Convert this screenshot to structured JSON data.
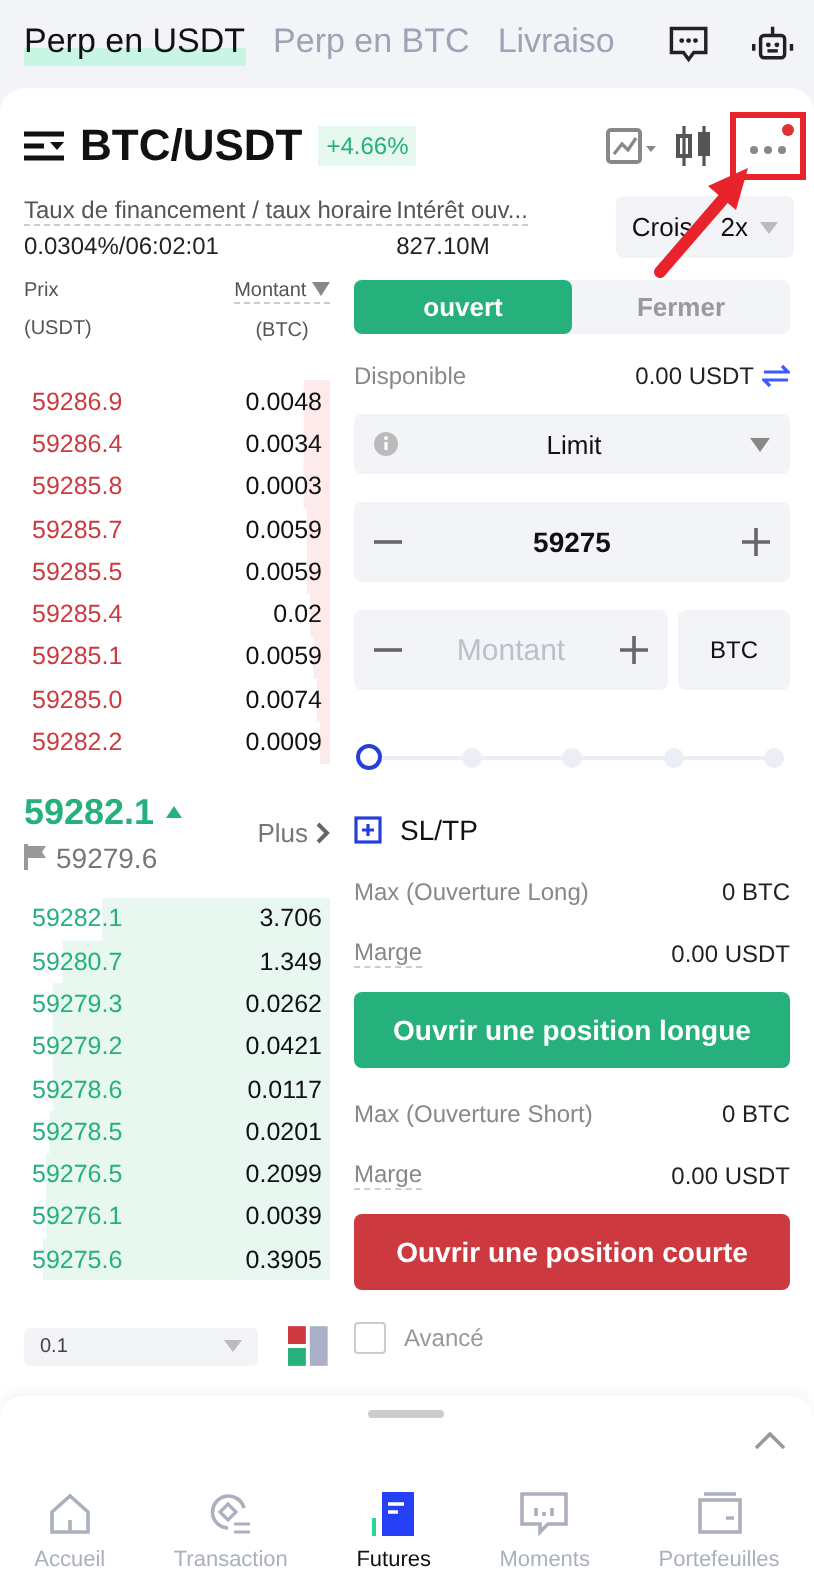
{
  "top_tabs": [
    {
      "label": "Perp en USDT",
      "selected": true
    },
    {
      "label": "Perp en BTC",
      "selected": false
    },
    {
      "label": "Livraiso",
      "selected": false
    }
  ],
  "pair": {
    "symbol": "BTC/USDT",
    "change": "+4.66%"
  },
  "funding": {
    "label": "Taux de financement / taux horaire",
    "value": "0.0304%/06:02:01"
  },
  "open_interest": {
    "label": "Intérêt ouv...",
    "value": "827.10M"
  },
  "margin_mode": [
    "Crois",
    "2x"
  ],
  "order_book": {
    "price_header": "Prix",
    "price_unit": "(USDT)",
    "amount_header": "Montant",
    "amount_unit": "(BTC)",
    "asks": [
      {
        "price": "59286.9",
        "amount": "0.0048"
      },
      {
        "price": "59286.4",
        "amount": "0.0034"
      },
      {
        "price": "59285.8",
        "amount": "0.0003"
      },
      {
        "price": "59285.7",
        "amount": "0.0059"
      },
      {
        "price": "59285.5",
        "amount": "0.0059"
      },
      {
        "price": "59285.4",
        "amount": "0.02"
      },
      {
        "price": "59285.1",
        "amount": "0.0059"
      },
      {
        "price": "59285.0",
        "amount": "0.0074"
      },
      {
        "price": "59282.2",
        "amount": "0.0009"
      }
    ],
    "last_price": "59282.1",
    "mark_price": "59279.6",
    "more": "Plus",
    "bids": [
      {
        "price": "59282.1",
        "amount": "3.706"
      },
      {
        "price": "59280.7",
        "amount": "1.349"
      },
      {
        "price": "59279.3",
        "amount": "0.0262"
      },
      {
        "price": "59279.2",
        "amount": "0.0421"
      },
      {
        "price": "59278.6",
        "amount": "0.0117"
      },
      {
        "price": "59278.5",
        "amount": "0.0201"
      },
      {
        "price": "59276.5",
        "amount": "0.2099"
      },
      {
        "price": "59276.1",
        "amount": "0.0039"
      },
      {
        "price": "59275.6",
        "amount": "0.3905"
      }
    ],
    "precision": "0.1"
  },
  "order_form": {
    "sides": [
      {
        "label": "ouvert",
        "selected": true
      },
      {
        "label": "Fermer",
        "selected": false
      }
    ],
    "available_label": "Disponible",
    "available_value": "0.00 USDT",
    "order_type": "Limit",
    "price": "59275",
    "amount_placeholder": "Montant",
    "amount_unit": "BTC",
    "slider": {
      "level": 0
    },
    "sltp": "SL/TP",
    "positions": [
      {
        "kind": "long",
        "max_label": "Max (Ouverture Long)",
        "max_value": "0 BTC",
        "margin_label": "Marge",
        "margin_value": "0.00 USDT",
        "button": "Ouvrir une position longue"
      },
      {
        "kind": "short",
        "max_label": "Max (Ouverture Short)",
        "max_value": "0 BTC",
        "margin_label": "Marge",
        "margin_value": "0.00 USDT",
        "button": "Ouvrir une position courte"
      }
    ],
    "advanced": {
      "label": "Avancé",
      "checked": false
    }
  },
  "nav": [
    {
      "kind": "home",
      "label": "Accueil",
      "selected": false
    },
    {
      "kind": "trade",
      "label": "Transaction",
      "selected": false
    },
    {
      "kind": "futures",
      "label": "Futures",
      "selected": true
    },
    {
      "kind": "moments",
      "label": "Moments",
      "selected": false
    },
    {
      "kind": "wallet",
      "label": "Portefeuilles",
      "selected": false
    }
  ]
}
